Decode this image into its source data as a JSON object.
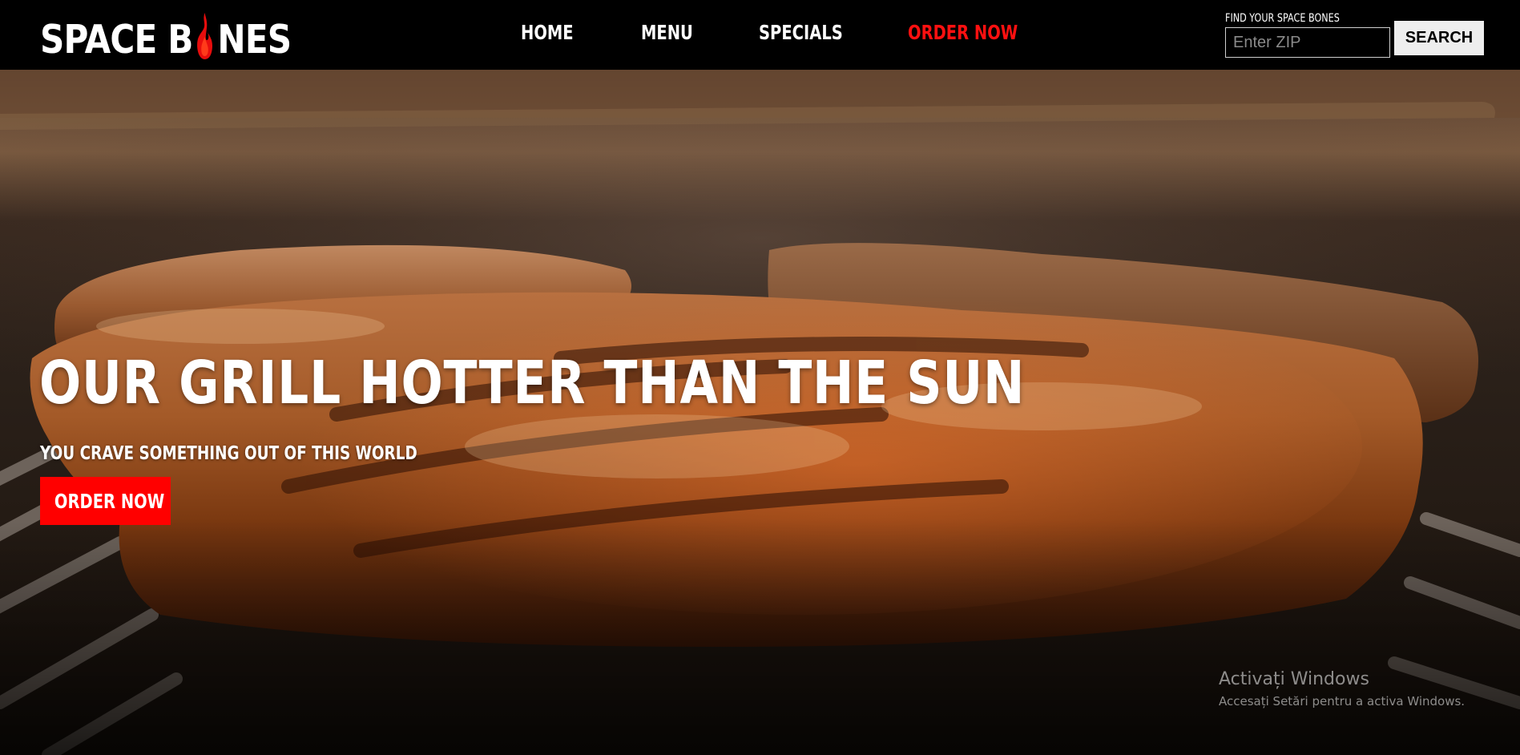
{
  "header": {
    "logo": {
      "part1": "SPACE B",
      "part2": "NES"
    },
    "nav": [
      {
        "label": "HOME"
      },
      {
        "label": "MENU"
      },
      {
        "label": "SPECIALS"
      },
      {
        "label": "ORDER NOW",
        "accent": true
      }
    ],
    "search": {
      "label": "FIND YOUR SPACE BONES",
      "placeholder": "Enter ZIP",
      "value": "",
      "button_label": "SEARCH"
    }
  },
  "hero": {
    "title": "OUR GRILL HOTTER THAN THE SUN",
    "subtitle": "YOU CRAVE SOMETHING OUT OF THIS WORLD",
    "cta_label": "ORDER NOW",
    "background": "grilled steaks on grill grates"
  },
  "os_watermark": {
    "title": "Activați Windows",
    "subtitle": "Accesați Setări pentru a activa Windows."
  },
  "colors": {
    "header_bg": "#000000",
    "accent_red": "#ff0000",
    "nav_text": "#ffffff",
    "search_button_bg": "#eeeeee"
  },
  "icons": {
    "logo_flame": "flame-icon"
  }
}
